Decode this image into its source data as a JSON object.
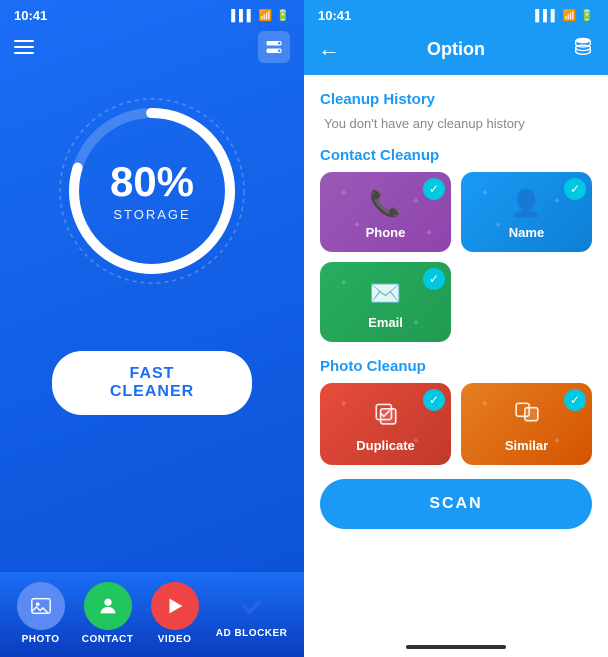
{
  "left": {
    "status_time": "10:41",
    "gauge_percent": "80%",
    "gauge_label": "STORAGE",
    "fast_cleaner_label": "FAST CLEANER",
    "nav_items": [
      {
        "id": "photo",
        "label": "PHOTO",
        "color": "photo",
        "icon": "🖼"
      },
      {
        "id": "contact",
        "label": "CONTACT",
        "color": "contact",
        "icon": "👤"
      },
      {
        "id": "video",
        "label": "VIDEO",
        "color": "video",
        "icon": "🎬"
      },
      {
        "id": "adblocker",
        "label": "AD BLOCKER",
        "color": "check",
        "icon": "✓"
      }
    ]
  },
  "right": {
    "status_time": "10:41",
    "header_title": "Option",
    "sections": {
      "cleanup_history": {
        "title": "Cleanup History",
        "empty_msg": "You don't have any cleanup history"
      },
      "contact_cleanup": {
        "title": "Contact Cleanup",
        "cards": [
          {
            "id": "phone",
            "label": "Phone",
            "style": "card-phone"
          },
          {
            "id": "name",
            "label": "Name",
            "style": "card-name"
          },
          {
            "id": "email",
            "label": "Email",
            "style": "card-email"
          }
        ]
      },
      "photo_cleanup": {
        "title": "Photo Cleanup",
        "cards": [
          {
            "id": "duplicate",
            "label": "Duplicate",
            "style": "card-duplicate"
          },
          {
            "id": "similar",
            "label": "Similar",
            "style": "card-similar"
          }
        ]
      }
    },
    "scan_label": "SCAN"
  }
}
